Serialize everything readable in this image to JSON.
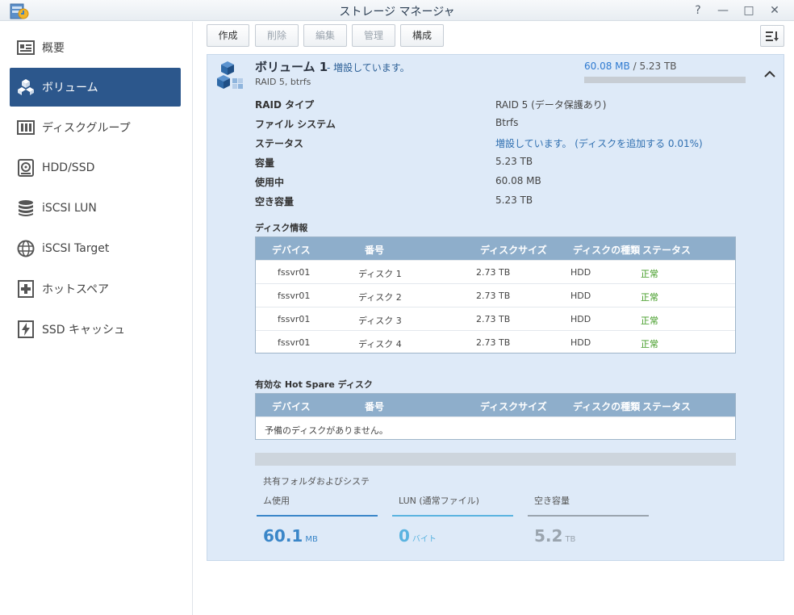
{
  "window": {
    "title": "ストレージ マネージャ",
    "help": "?",
    "minimize": "—",
    "maximize": "□",
    "close": "✕"
  },
  "sidebar": {
    "items": [
      {
        "label": "概要",
        "icon": "overview-icon",
        "active": false
      },
      {
        "label": "ボリューム",
        "icon": "volume-icon",
        "active": true
      },
      {
        "label": "ディスクグループ",
        "icon": "disk-group-icon",
        "active": false
      },
      {
        "label": "HDD/SSD",
        "icon": "hdd-icon",
        "active": false
      },
      {
        "label": "iSCSI LUN",
        "icon": "database-icon",
        "active": false
      },
      {
        "label": "iSCSI Target",
        "icon": "globe-icon",
        "active": false
      },
      {
        "label": "ホットスペア",
        "icon": "plus-box-icon",
        "active": false
      },
      {
        "label": "SSD キャッシュ",
        "icon": "lightning-icon",
        "active": false
      }
    ]
  },
  "toolbar": {
    "create": "作成",
    "delete": "削除",
    "edit": "編集",
    "manage": "管理",
    "configure": "構成"
  },
  "volume": {
    "title": "ボリューム 1",
    "status": "- 増設しています。",
    "subtitle": "RAID 5, btrfs",
    "used": "60.08 MB",
    "separator": " / ",
    "total": "5.23 TB",
    "usage_fraction": 0.0,
    "properties": [
      {
        "label": "RAID タイプ",
        "value": "RAID 5 (データ保護あり)",
        "highlight": false
      },
      {
        "label": "ファイル システム",
        "value": "Btrfs",
        "highlight": false
      },
      {
        "label": "ステータス",
        "value": "増設しています。 (ディスクを追加する 0.01%)",
        "highlight": true
      },
      {
        "label": "容量",
        "value": "5.23 TB",
        "highlight": false
      },
      {
        "label": "使用中",
        "value": "60.08 MB",
        "highlight": false
      },
      {
        "label": "空き容量",
        "value": "5.23 TB",
        "highlight": false
      }
    ]
  },
  "disk_info": {
    "label": "ディスク情報",
    "columns": [
      "デバイス",
      "番号",
      "ディスクサイズ",
      "ディスクの種類",
      "ステータス"
    ],
    "rows": [
      [
        "fssvr01",
        "ディスク 1",
        "2.73 TB",
        "HDD",
        "正常"
      ],
      [
        "fssvr01",
        "ディスク 2",
        "2.73 TB",
        "HDD",
        "正常"
      ],
      [
        "fssvr01",
        "ディスク 3",
        "2.73 TB",
        "HDD",
        "正常"
      ],
      [
        "fssvr01",
        "ディスク 4",
        "2.73 TB",
        "HDD",
        "正常"
      ]
    ]
  },
  "hot_spare": {
    "label": "有効な Hot Spare ディスク",
    "columns": [
      "デバイス",
      "番号",
      "ディスクサイズ",
      "ディスクの種類",
      "ステータス"
    ],
    "empty_message": "予備のディスクがありません。"
  },
  "stats": [
    {
      "label_line1": "共有フォルダおよびシステ",
      "label_line2": "ム使用",
      "value": "60.1",
      "unit": "MB",
      "color": "#3a86c8"
    },
    {
      "label_line1": "",
      "label_line2": "LUN (通常ファイル)",
      "value": "0",
      "unit": "バイト",
      "color": "#5ab3e0"
    },
    {
      "label_line1": "",
      "label_line2": "空き容量",
      "value": "5.2",
      "unit": "TB",
      "color": "#9aa4ae"
    }
  ]
}
